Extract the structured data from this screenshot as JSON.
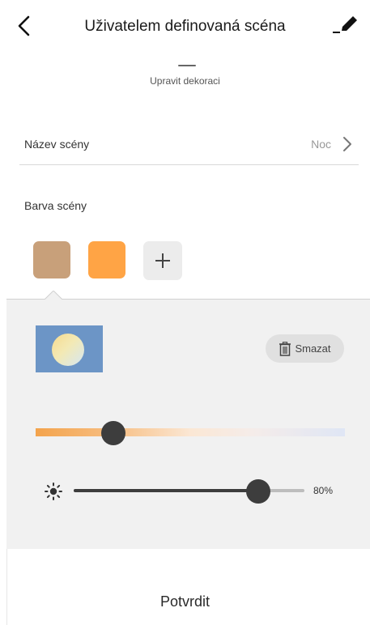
{
  "header": {
    "title": "Uživatelem definovaná scéna",
    "back_icon": "chevron-left-icon",
    "edit_icon": "pen-icon"
  },
  "decoration": {
    "label": "Upravit dekoraci"
  },
  "scene_name": {
    "label": "Název scény",
    "value": "Noc"
  },
  "scene_color": {
    "label": "Barva scény",
    "swatches": [
      {
        "color": "#c8a07a",
        "selected": true
      },
      {
        "color": "#ffa445",
        "selected": false
      }
    ],
    "add_icon": "plus-icon"
  },
  "panel": {
    "delete_label": "Smazat",
    "delete_icon": "trash-icon",
    "color_temperature_fraction": 0.25,
    "brightness_percent": 80,
    "brightness_label": "80%",
    "brightness_icon": "sun-icon"
  },
  "footer": {
    "confirm_label": "Potvrdit"
  },
  "colors": {
    "preview_bg": "#6c95c6",
    "slider_thumb": "#3d3d3d",
    "panel_bg": "#f1f1f1"
  }
}
